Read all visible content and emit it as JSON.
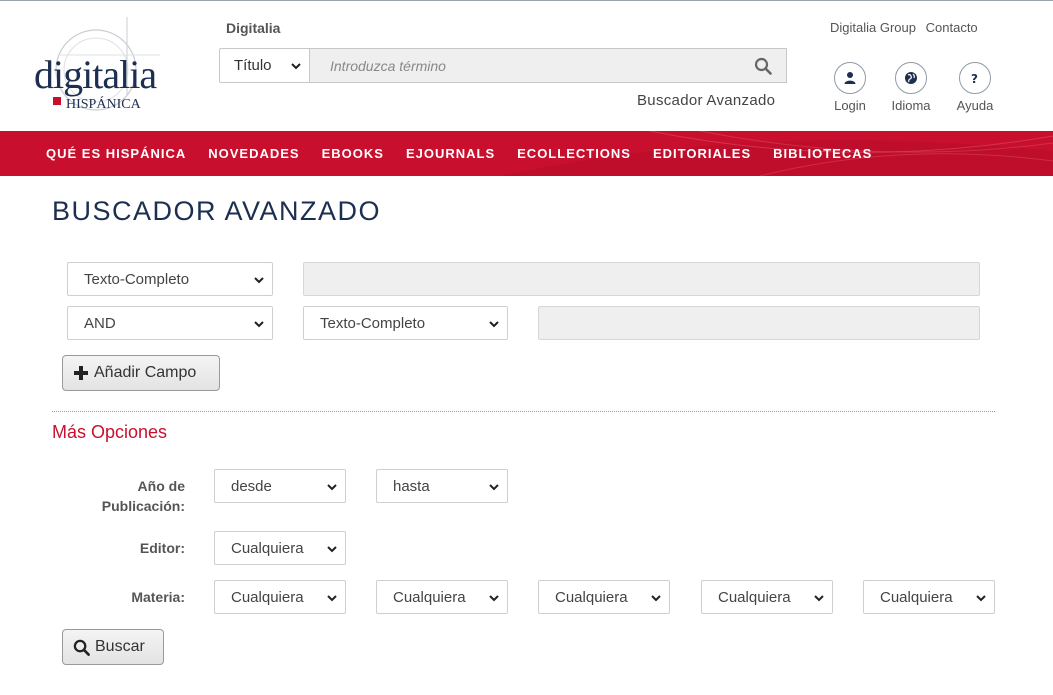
{
  "header": {
    "logo_text": "digitalia",
    "logo_sub": "HISPÁNICA",
    "site_name": "Digitalia",
    "search": {
      "type_selected": "Título",
      "placeholder": "Introduzca término"
    },
    "advanced_link": "Buscador Avanzado",
    "top_links": [
      "Digitalia Group",
      "Contacto"
    ],
    "buttons": {
      "login": "Login",
      "language": "Idioma",
      "help": "Ayuda"
    }
  },
  "nav": {
    "items": [
      "QUÉ ES HISPÁNICA",
      "NOVEDADES",
      "EBOOKS",
      "EJOURNALS",
      "ECOLLECTIONS",
      "EDITORIALES",
      "BIBLIOTECAS"
    ]
  },
  "main": {
    "title": "BUSCADOR AVANZADO",
    "row1": {
      "field": "Texto-Completo"
    },
    "row2": {
      "operator": "AND",
      "field": "Texto-Completo"
    },
    "add_field": "Añadir Campo",
    "more_options": "Más Opciones",
    "year": {
      "label_line1": "Año de",
      "label_line2": "Publicación:",
      "from": "desde",
      "to": "hasta"
    },
    "editor": {
      "label": "Editor:",
      "value": "Cualquiera"
    },
    "subject": {
      "label": "Materia:",
      "values": [
        "Cualquiera",
        "Cualquiera",
        "Cualquiera",
        "Cualquiera",
        "Cualquiera"
      ]
    },
    "search_button": "Buscar"
  },
  "colors": {
    "brand_red": "#c8102e",
    "brand_navy": "#1c2f50"
  }
}
